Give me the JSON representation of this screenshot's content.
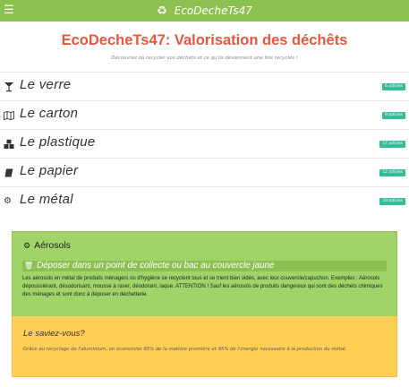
{
  "header": {
    "menu_icon": "bars-icon",
    "brand_icon": "recycle-icon",
    "brand_name": "EcoDecheTs47"
  },
  "main": {
    "title": "EcoDecheTs47: Valorisation des déchêts",
    "subtitle": "Découvrez où recycler vos déchets et ce qu'ils deviennent une fois recyclés !"
  },
  "categories": [
    {
      "icon": "glass-icon",
      "label": "Le verre",
      "count": "6 articles"
    },
    {
      "icon": "map-icon",
      "label": "Le carton",
      "count": "9 articles"
    },
    {
      "icon": "cubes-icon",
      "label": "Le plastique",
      "count": "17 articles"
    },
    {
      "icon": "book-icon",
      "label": "Le papier",
      "count": "12 articles"
    },
    {
      "icon": "gears-icon",
      "label": "Le métal",
      "count": "10 articles"
    }
  ],
  "article": {
    "icon": "gears-icon",
    "title": "Aérosols",
    "bin_icon": "trash-icon",
    "bin_instruction": "Déposer dans un point de collecte ou bac au couvercle jaune",
    "description": "Les aérosols en métal de produits ménagers ou d'hygiène se recyclent tous et se trient bien vidés, avec leur couvercle/capuchon. Exemples : Aérosols dépoussiérant, désodorisant, mousse à raser, déodorant, laque. ATTENTION ! Sauf les aérosols de produits dangereux qui sont des déchets chimiques des ménages et sont donc à déposer en déchetterie."
  },
  "fact": {
    "title": "Le saviez-vous?",
    "text": "Grâce au recyclage de l'aluminium, on économise 95% de la matière première et 95% de l'énergie nécessaire à la production du métal."
  },
  "colors": {
    "topbar": "#8cc152",
    "title": "#e9573f",
    "badge": "#37bc9b",
    "article_bg": "#a0d468",
    "fact_bg": "#ffce54"
  }
}
